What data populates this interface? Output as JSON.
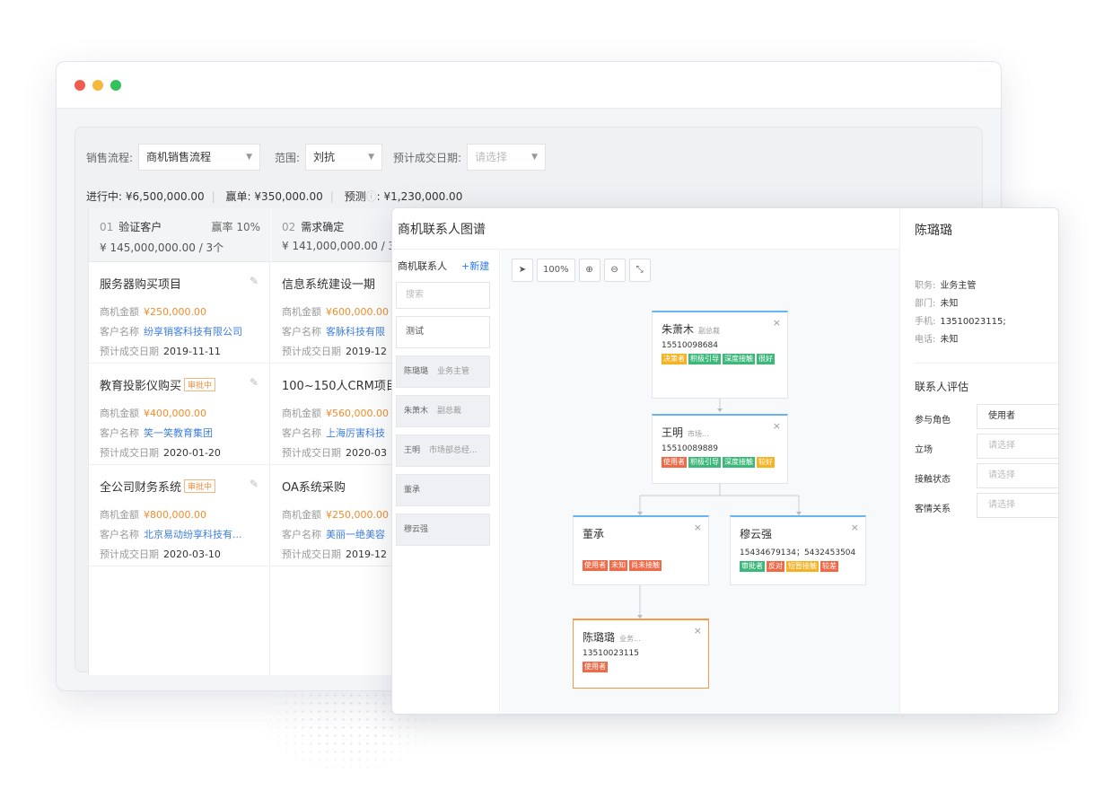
{
  "filters": {
    "flow_label": "销售流程:",
    "flow_value": "商机销售流程",
    "scope_label": "范围:",
    "scope_value": "刘抗",
    "date_label": "预计成交日期:",
    "date_placeholder": "请选择"
  },
  "summary": {
    "in_progress_label": "进行中:",
    "in_progress": "¥6,500,000.00",
    "won_label": "赢单:",
    "won": "¥350,000.00",
    "forecast_label": "预测",
    "forecast": "¥1,230,000.00"
  },
  "columns": [
    {
      "num": "01",
      "name": "验证客户",
      "rate": "赢率 10%",
      "amount": "¥ 145,000,000.00 / 3个"
    },
    {
      "num": "02",
      "name": "需求确定",
      "amount": "¥ 141,000,000.00 / 3"
    }
  ],
  "field_labels": {
    "amount": "商机金额",
    "customer": "客户名称",
    "date": "预计成交日期"
  },
  "deals_col1": [
    {
      "name": "服务器购买项目",
      "amount": "¥250,000.00",
      "customer": "纷享销客科技有限公司",
      "date": "2019-11-11",
      "tag": ""
    },
    {
      "name": "教育投影仪购买",
      "amount": "¥400,000.00",
      "customer": "笑一笑教育集团",
      "date": "2020-01-20",
      "tag": "审批中"
    },
    {
      "name": "全公司财务系统",
      "amount": "¥800,000.00",
      "customer": "北京易动纷享科技有...",
      "date": "2020-03-10",
      "tag": "审批中"
    }
  ],
  "deals_col2": [
    {
      "name": "信息系统建设一期",
      "amount": "¥600,000.00",
      "customer": "客脉科技有限",
      "date": "2019-12"
    },
    {
      "name": "100~150人CRM项目",
      "amount": "¥560,000.00",
      "customer": "上海厉害科技",
      "date": "2020-03"
    },
    {
      "name": "OA系统采购",
      "amount": "¥250,000.00",
      "customer": "美丽一绝美容",
      "date": "2019-12"
    }
  ],
  "graph": {
    "title": "商机联系人图谱",
    "sidebar": {
      "header": "商机联系人",
      "new_label": "+新建",
      "search_placeholder": "搜索",
      "input_value": "测试",
      "contacts": [
        {
          "name": "陈璐璐",
          "role": "业务主管"
        },
        {
          "name": "朱萧木",
          "role": "副总裁"
        },
        {
          "name": "王明",
          "role": "市场部总经..."
        },
        {
          "name": "董承",
          "role": ""
        },
        {
          "name": "穆云强",
          "role": ""
        }
      ]
    },
    "toolbar": {
      "zoom": "100%"
    },
    "close": "×",
    "nodes": [
      {
        "name": "朱萧木",
        "role": "副总裁",
        "phone": "15510098684",
        "tags": [
          {
            "t": "决策者",
            "c": "#f5b324"
          },
          {
            "t": "积极引导",
            "c": "#3db87a"
          },
          {
            "t": "深度接触",
            "c": "#3db87a"
          },
          {
            "t": "很好",
            "c": "#3db87a"
          }
        ]
      },
      {
        "name": "王明",
        "role": "市场...",
        "phone": "15510089889",
        "tags": [
          {
            "t": "使用者",
            "c": "#ef6a48"
          },
          {
            "t": "积极引导",
            "c": "#3db87a"
          },
          {
            "t": "深度接触",
            "c": "#3db87a"
          },
          {
            "t": "较好",
            "c": "#f5b324"
          }
        ]
      },
      {
        "name": "董承",
        "role": "",
        "phone": "",
        "tags": [
          {
            "t": "使用者",
            "c": "#ef6a48"
          },
          {
            "t": "未知",
            "c": "#ef6a48"
          },
          {
            "t": "尚未接触",
            "c": "#ef6a48"
          }
        ]
      },
      {
        "name": "穆云强",
        "role": "",
        "phone": "15434679134；5432453504",
        "tags": [
          {
            "t": "审批者",
            "c": "#3db87a"
          },
          {
            "t": "反对",
            "c": "#ef6a48"
          },
          {
            "t": "短暂接触",
            "c": "#f5b324"
          },
          {
            "t": "较差",
            "c": "#ef6a48"
          }
        ]
      },
      {
        "name": "陈璐璐",
        "role": "业务...",
        "phone": "13510023115",
        "tags": [
          {
            "t": "使用者",
            "c": "#ef6a48"
          }
        ]
      }
    ]
  },
  "detail": {
    "name": "陈璐璐",
    "title_label": "职务:",
    "title": "业务主管",
    "dept_label": "部门:",
    "dept": "未知",
    "mobile_label": "手机:",
    "mobile": "13510023115;",
    "phone_label": "电话:",
    "phone": "未知",
    "eval_title": "联系人评估",
    "role_label": "参与角色",
    "role_value": "使用者",
    "stance_label": "立场",
    "stance_placeholder": "请选择",
    "contact_label": "接触状态",
    "contact_placeholder": "请选择",
    "relation_label": "客情关系",
    "relation_placeholder": "请选择"
  }
}
